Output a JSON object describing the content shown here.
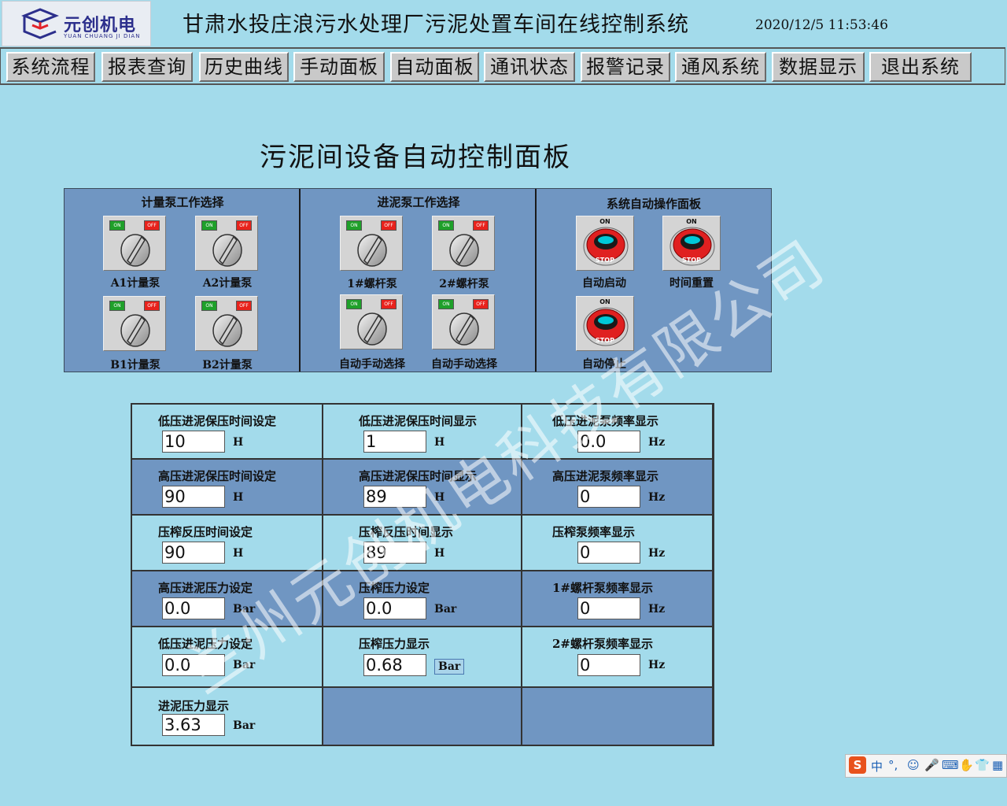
{
  "header": {
    "logo_cn": "元创机电",
    "logo_en": "YUAN CHUANG JI DIAN",
    "title": "甘肃水投庄浪污水处理厂污泥处置车间在线控制系统",
    "datetime": "2020/12/5 11:53:46"
  },
  "nav": [
    "系统流程",
    "报表查询",
    "历史曲线",
    "手动面板",
    "自动面板",
    "通讯状态",
    "报警记录",
    "通风系统",
    "数据显示",
    "退出系统"
  ],
  "page_title": "污泥间设备自动控制面板",
  "panel": {
    "meter_title": "计量泵工作选择",
    "meter": [
      "A1计量泵",
      "A2计量泵",
      "B1计量泵",
      "B2计量泵"
    ],
    "feed_title": "进泥泵工作选择",
    "feed": [
      "1#螺杆泵",
      "2#螺杆泵",
      "自动手动选择",
      "自动手动选择"
    ],
    "auto_title": "系统自动操作面板",
    "auto": [
      "自动启动",
      "时间重置",
      "自动停止"
    ],
    "sel_on": "ON",
    "sel_off": "OFF",
    "btn_on": "ON",
    "btn_stop": "STOP"
  },
  "grid": {
    "r0c0": {
      "label": "低压进泥保压时间设定",
      "value": "10",
      "unit": "H"
    },
    "r0c1": {
      "label": "低压进泥保压时间显示",
      "value": "1",
      "unit": "H"
    },
    "r0c2": {
      "label": "低压进泥泵频率显示",
      "value": "0.0",
      "unit": "Hz"
    },
    "r1c0": {
      "label": "高压进泥保压时间设定",
      "value": "90",
      "unit": "H"
    },
    "r1c1": {
      "label": "高压进泥保压时间显示",
      "value": "89",
      "unit": "H"
    },
    "r1c2": {
      "label": "高压进泥泵频率显示",
      "value": "0",
      "unit": "Hz"
    },
    "r2c0": {
      "label": "压榨反压时间设定",
      "value": "90",
      "unit": "H"
    },
    "r2c1": {
      "label": "压榨反压时间显示",
      "value": "89",
      "unit": "H"
    },
    "r2c2": {
      "label": "压榨泵频率显示",
      "value": "0",
      "unit": "Hz"
    },
    "r3c0": {
      "label": "高压进泥压力设定",
      "value": "0.0",
      "unit": "Bar"
    },
    "r3c1": {
      "label": "压榨压力设定",
      "value": "0.0",
      "unit": "Bar"
    },
    "r3c2": {
      "label": "1#螺杆泵频率显示",
      "value": "0",
      "unit": "Hz"
    },
    "r4c0": {
      "label": "低压进泥压力设定",
      "value": "0.0",
      "unit": "Bar"
    },
    "r4c1": {
      "label": "压榨压力显示",
      "value": "0.68",
      "unit": "Bar"
    },
    "r4c2": {
      "label": "2#螺杆泵频率显示",
      "value": "0",
      "unit": "Hz"
    },
    "r5c0": {
      "label": "进泥压力显示",
      "value": "3.63",
      "unit": "Bar"
    }
  },
  "watermark": "兰州元创机电科技有限公司",
  "ime": {
    "lang": "中",
    "punct": "°,"
  },
  "colors": {
    "background": "#a3dbeb",
    "panel": "#7096c2",
    "on_led": "#1fa02a",
    "off_led": "#e8221c",
    "stop_red": "#e02020"
  }
}
